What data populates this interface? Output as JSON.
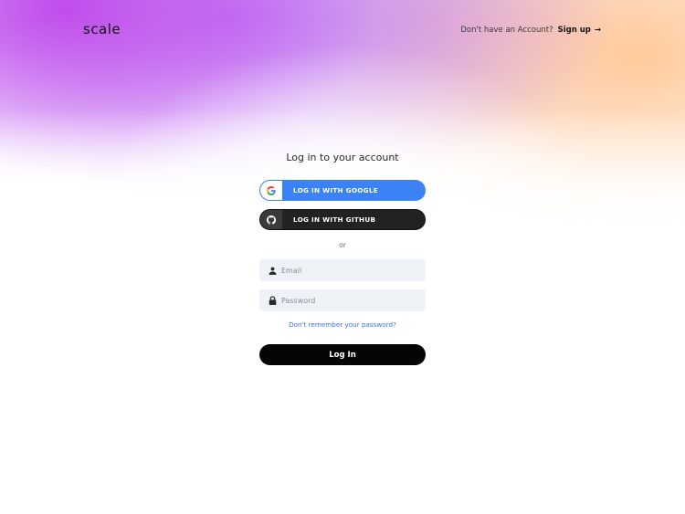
{
  "header": {
    "logo_text": "scale",
    "signup_prompt": "Don't have an Account?",
    "signup_label": "Sign up",
    "signup_arrow": "→"
  },
  "form": {
    "title": "Log in to your account",
    "google_label": "LOG IN WITH GOOGLE",
    "github_label": "LOG IN WITH GITHUB",
    "separator": "or",
    "email_placeholder": "Email",
    "password_placeholder": "Password",
    "forgot_label": "Don't remember your password?",
    "login_label": "Log In"
  },
  "icons": {
    "google": "google-icon",
    "github": "github-icon",
    "email": "user-icon",
    "password": "lock-icon"
  },
  "colors": {
    "google_button": "#3b82f6",
    "github_button": "#222222",
    "login_button": "#050505",
    "link": "#3b6fd8",
    "field_bg": "#eef1f5"
  }
}
